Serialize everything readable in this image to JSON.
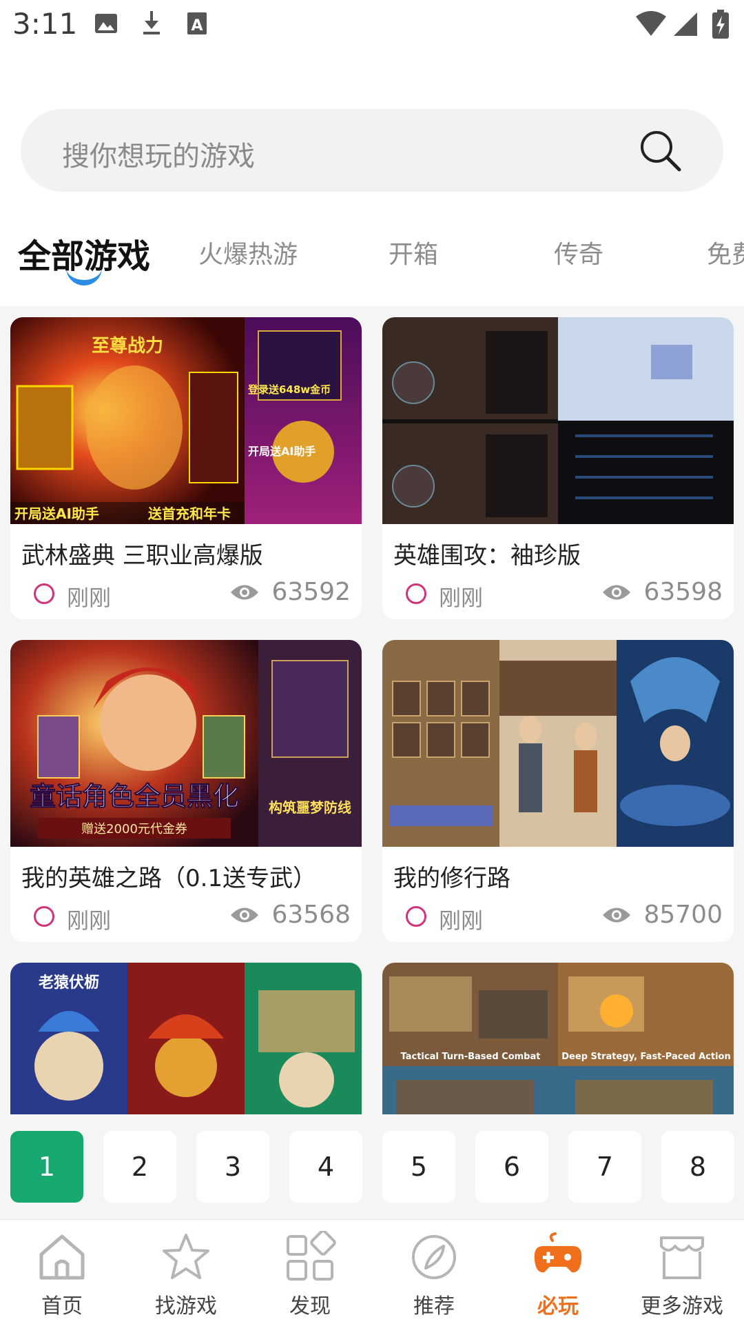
{
  "status_bar": {
    "time": "3:11"
  },
  "search": {
    "placeholder": "搜你想玩的游戏"
  },
  "tabs": [
    {
      "label": "全部游戏",
      "active": true
    },
    {
      "label": "火爆热游"
    },
    {
      "label": "开箱"
    },
    {
      "label": "传奇"
    },
    {
      "label": "免费"
    }
  ],
  "games": [
    {
      "title": "武林盛典 三职业高爆版",
      "time": "刚刚",
      "views": "63592"
    },
    {
      "title": "英雄围攻：袖珍版",
      "time": "刚刚",
      "views": "63598"
    },
    {
      "title": "我的英雄之路（0.1送专武）",
      "time": "刚刚",
      "views": "63568"
    },
    {
      "title": "我的修行路",
      "time": "刚刚",
      "views": "85700"
    }
  ],
  "thumb_text": {
    "g1_a": "至尊战力",
    "g1_b": "开局送AI助手",
    "g1_c": "送首充和年卡",
    "g1_d": "登录送648w金币",
    "g1_e": "开局送AI助手",
    "g3_a": "童话角色全员黑化",
    "g3_b": "赠送2000元代金券",
    "g3_c": "构筑噩梦防线",
    "g5_a": "老猿伏枥",
    "g6_a": "Tactical Turn-Based Combat",
    "g6_b": "Deep Strategy, Fast-Paced Action"
  },
  "pagination": [
    "1",
    "2",
    "3",
    "4",
    "5",
    "6",
    "7",
    "8"
  ],
  "bottom_nav": [
    {
      "label": "首页",
      "icon": "home-icon"
    },
    {
      "label": "找游戏",
      "icon": "star-icon"
    },
    {
      "label": "发现",
      "icon": "grid-icon"
    },
    {
      "label": "推荐",
      "icon": "compass-icon"
    },
    {
      "label": "必玩",
      "icon": "gamepad-icon",
      "active": true
    },
    {
      "label": "更多游戏",
      "icon": "store-icon"
    }
  ],
  "colors": {
    "accent_green": "#16a86f",
    "accent_orange": "#f06f1a",
    "tab_indicator": "#2b8ce6"
  }
}
